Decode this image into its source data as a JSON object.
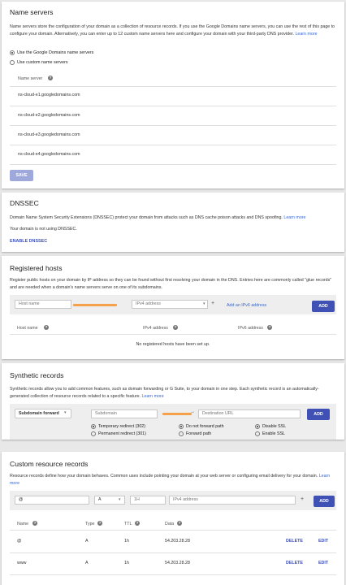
{
  "name_servers": {
    "title": "Name servers",
    "description": "Name servers store the configuration of your domain as a collection of resource records. If you use the Google Domains name servers, you can use the rest of this page to configure your domain. Alternatively, you can enter up to 12 custom name servers here and configure your domain with your third-party DNS provider.",
    "learn_more": "Learn more",
    "option_google": "Use the Google Domains name servers",
    "option_custom": "Use custom name servers",
    "column_header": "Name server",
    "servers": [
      "ns-cloud-e1.googledomains.com",
      "ns-cloud-e2.googledomains.com",
      "ns-cloud-e3.googledomains.com",
      "ns-cloud-e4.googledomains.com"
    ],
    "save_label": "SAVE"
  },
  "dnssec": {
    "title": "DNSSEC",
    "description": "Domain Name System Security Extensions (DNSSEC) protect your domain from attacks such as DNS cache poison attacks and DNS spoofing.",
    "learn_more": "Learn more",
    "status": "Your domain is not using DNSSEC.",
    "enable_label": "ENABLE DNSSEC"
  },
  "registered_hosts": {
    "title": "Registered hosts",
    "description": "Register public hosts on your domain by IP address so they can be found without first resolving your domain in the DNS. Entries here are commonly called \"glue records\" and are needed when a domain's name servers serve on one of its subdomains.",
    "host_placeholder": "Host name",
    "ipv4_placeholder": "IPv4 address",
    "plus": "+",
    "add_ipv6": "Add an IPv6 address",
    "add_label": "ADD",
    "col_host": "Host name",
    "col_ipv4": "IPv4 address",
    "col_ipv6": "IPv6 address",
    "empty": "No registered hosts have been set up."
  },
  "synthetic": {
    "title": "Synthetic records",
    "description": "Synthetic records allow you to add common features, such as domain forwarding or G Suite, to your domain in one step. Each synthetic record is an automatically-generated collection of resource records related to a specific feature.",
    "learn_more": "Learn more",
    "type_select": "Subdomain forward",
    "subdomain_placeholder": "Subdomain",
    "dest_placeholder": "Destination URL",
    "arrow": "→",
    "add_label": "ADD",
    "redirect_temp": "Temporary redirect (302)",
    "redirect_perm": "Permanent redirect (301)",
    "path_no": "Do not forward path",
    "path_yes": "Forward path",
    "ssl_off": "Disable SSL",
    "ssl_on": "Enable SSL"
  },
  "custom": {
    "title": "Custom resource records",
    "description": "Resource records define how your domain behaves. Common uses include pointing your domain at your web server or configuring email delivery for your domain.",
    "learn_more": "Learn more",
    "name_value": "@",
    "type_value": "A",
    "ttl_placeholder": "1H",
    "ip_placeholder": "IPv4 address",
    "plus": "+",
    "add_label": "ADD",
    "col_name": "Name",
    "col_type": "Type",
    "col_ttl": "TTL",
    "col_data": "Data",
    "rows": [
      {
        "name": "@",
        "type": "A",
        "ttl": "1h",
        "data": "54.203.28.28",
        "delete": "DELETE",
        "edit": "EDIT"
      },
      {
        "name": "www",
        "type": "A",
        "ttl": "1h",
        "data": "54.203.28.28",
        "delete": "DELETE",
        "edit": "EDIT"
      }
    ]
  },
  "colors": {
    "accent": "#3f51b5",
    "link": "#3367d6",
    "redaction": "#f5a04a"
  }
}
